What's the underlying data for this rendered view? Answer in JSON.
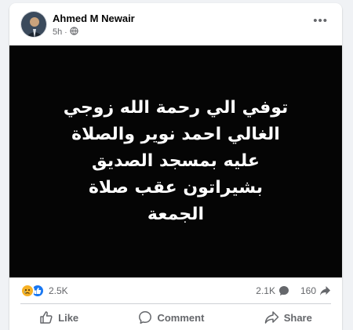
{
  "post": {
    "author": "Ahmed M Newair",
    "time": "5h",
    "visibility_icon": "globe-icon",
    "more_label": "•••",
    "content_text": "توفي الي رحمة الله زوجي الغالي احمد نوير والصلاة عليه بمسجد الصديق بشيراتون عقب صلاة الجمعة"
  },
  "stats": {
    "reaction_icons": [
      "sad-reaction-icon",
      "like-reaction-icon"
    ],
    "reactions_count": "2.5K",
    "comments_count": "2.1K",
    "shares_count": "160"
  },
  "actions": {
    "like_label": "Like",
    "comment_label": "Comment",
    "share_label": "Share"
  },
  "colors": {
    "media_background": "#050505",
    "like_blue": "#1877f2",
    "sad_yellow": "#f7b125",
    "secondary_text": "#65676b"
  }
}
